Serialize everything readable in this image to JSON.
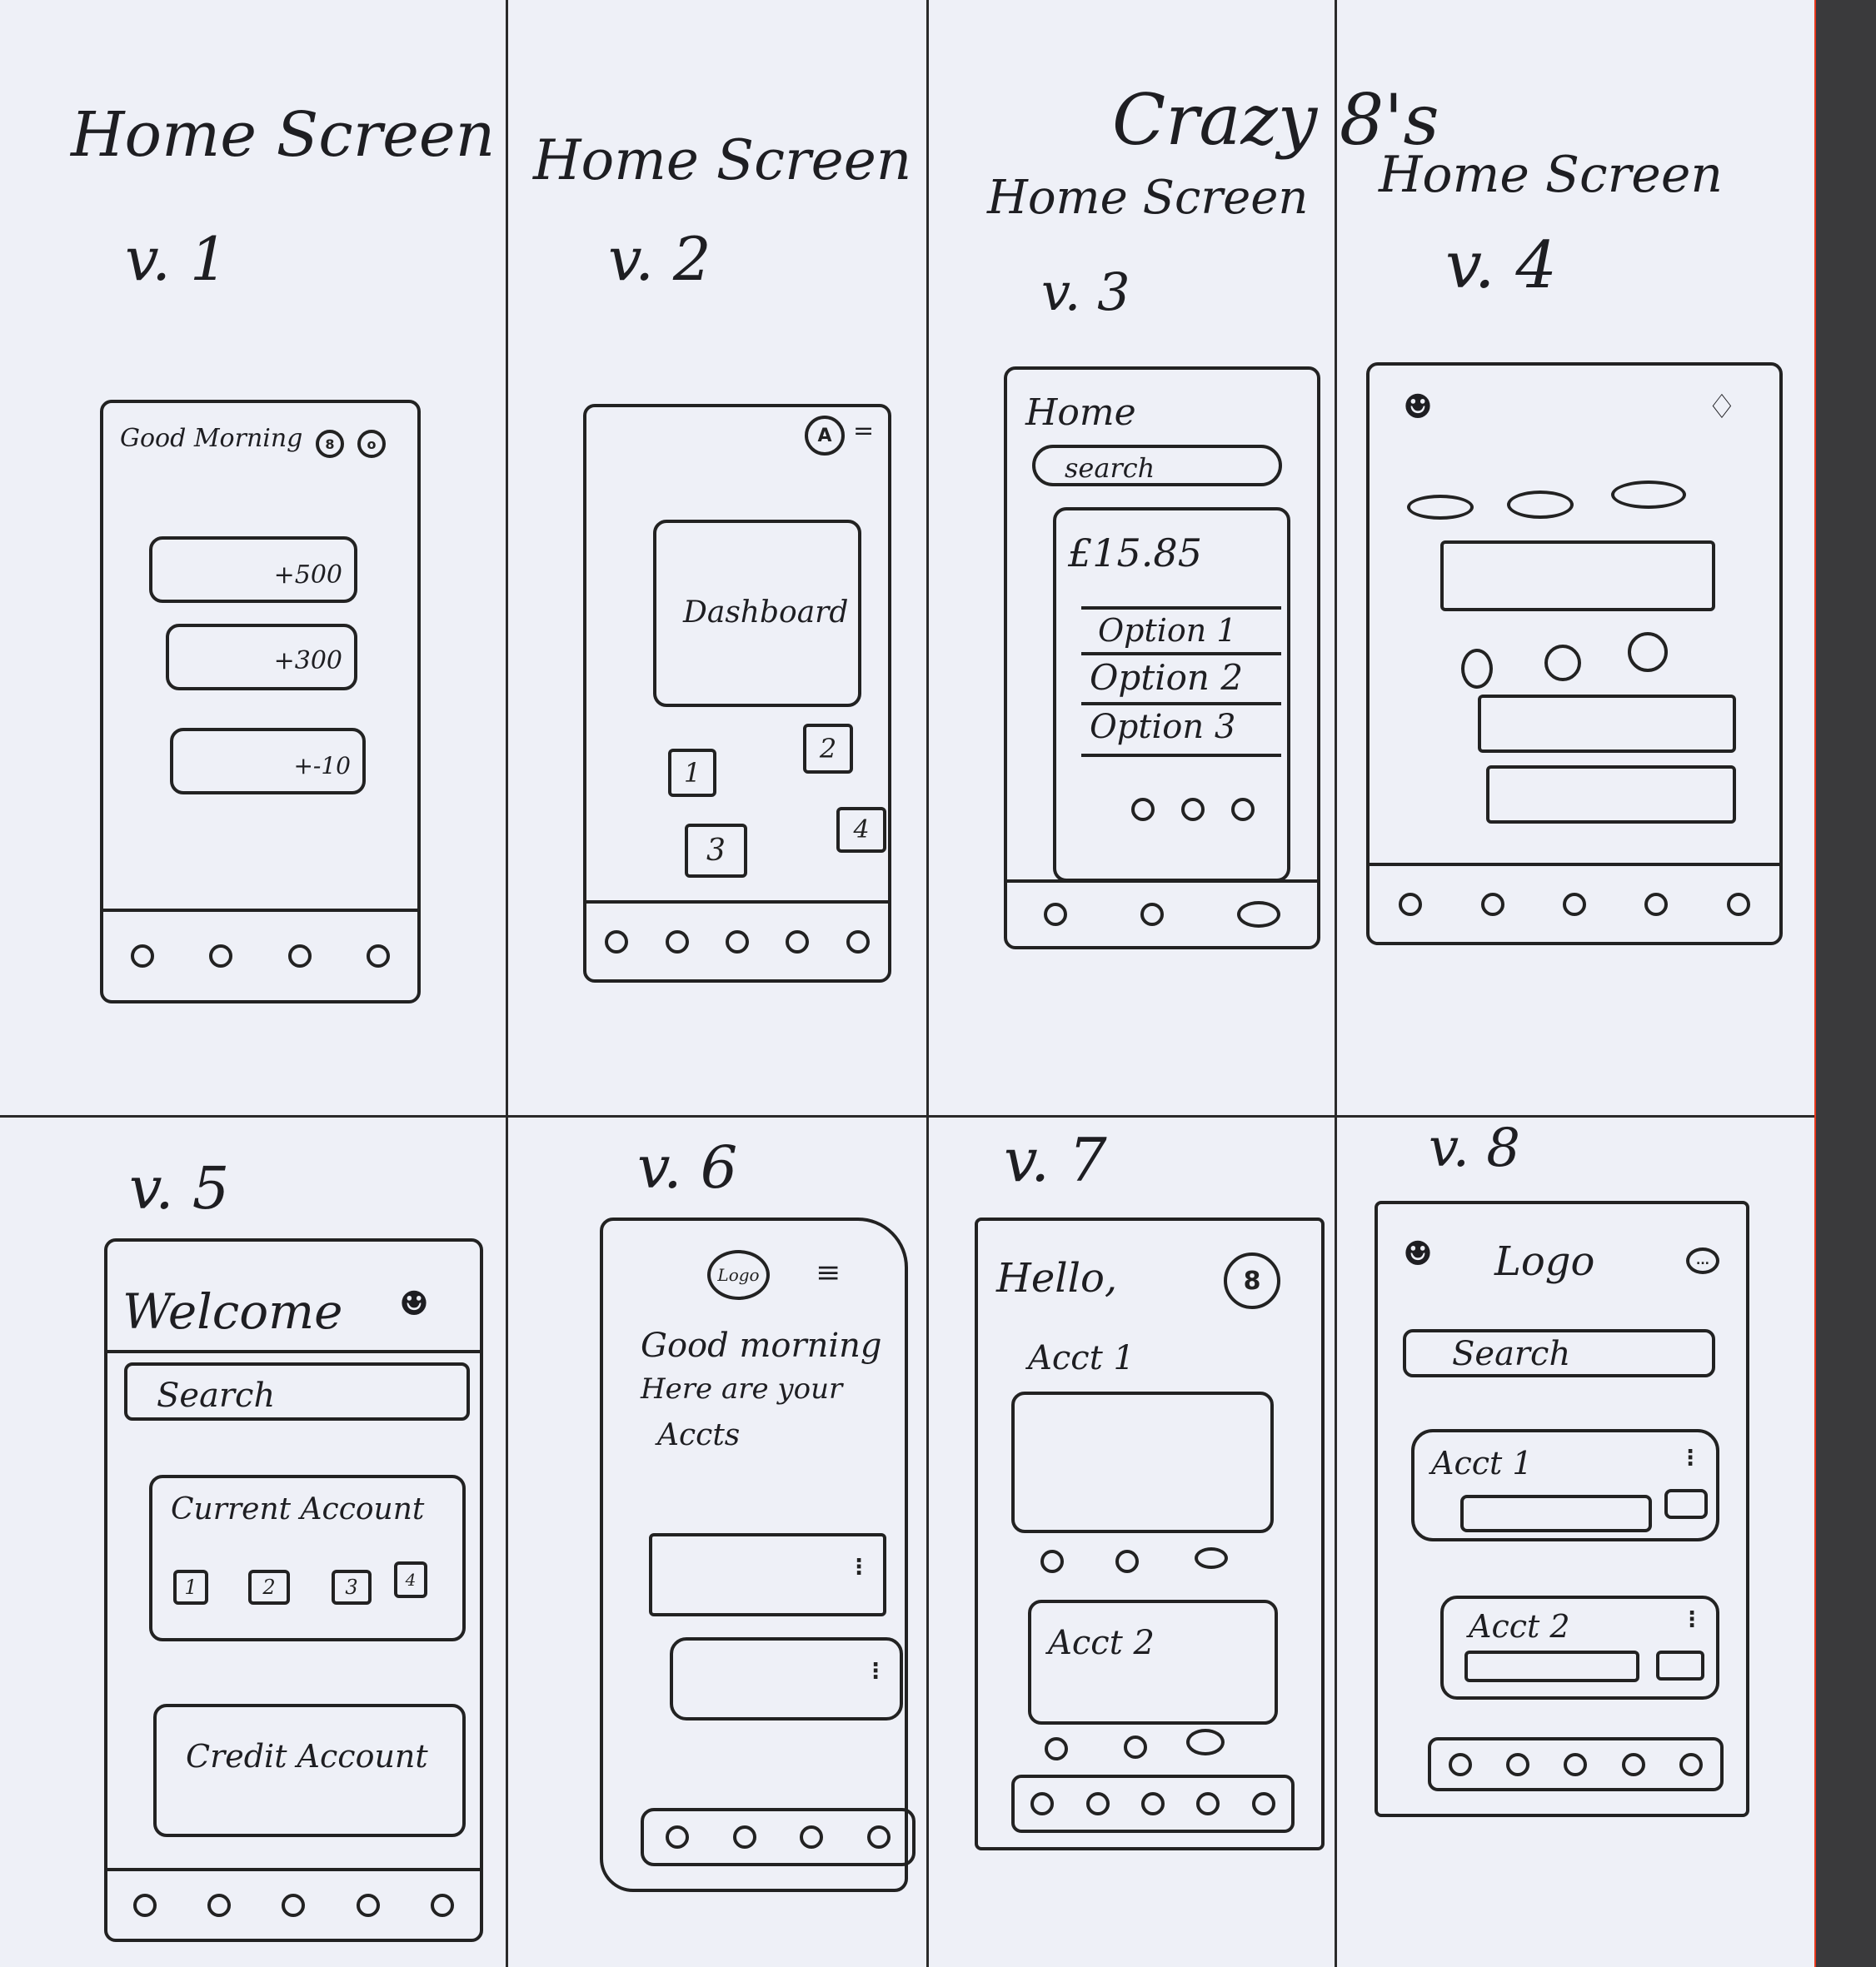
{
  "header": {
    "crazy_label": "Crazy 8's"
  },
  "sketches": [
    {
      "title": "Home Screen",
      "version": "v. 1",
      "greeting": "Good Morning",
      "amounts": [
        "+500",
        "+300",
        "+-10"
      ]
    },
    {
      "title": "Home Screen",
      "version": "v. 2",
      "avatar": "A",
      "dashboard": "Dashboard",
      "tiles": [
        "1",
        "2",
        "3",
        "4"
      ]
    },
    {
      "title": "Home Screen",
      "version": "v. 3",
      "heading": "Home",
      "search": "search",
      "balance": "£15.85",
      "options": [
        "Option 1",
        "Option 2",
        "Option 3"
      ]
    },
    {
      "title": "Home Screen",
      "version": "v. 4"
    },
    {
      "version": "v. 5",
      "heading": "Welcome",
      "search": "Search",
      "current": "Current Account",
      "tiles": [
        "1",
        "2",
        "3",
        "4"
      ],
      "credit": "Credit Account"
    },
    {
      "version": "v. 6",
      "logo": "Logo",
      "greeting_line1": "Good morning",
      "greeting_line2": "Here are your",
      "greeting_line3": "Accts"
    },
    {
      "version": "v. 7",
      "heading": "Hello,",
      "acct1": "Acct 1",
      "acct2": "Acct 2"
    },
    {
      "version": "v. 8",
      "logo": "Logo",
      "search": "Search",
      "acct1": "Acct 1",
      "acct2": "Acct 2"
    }
  ]
}
